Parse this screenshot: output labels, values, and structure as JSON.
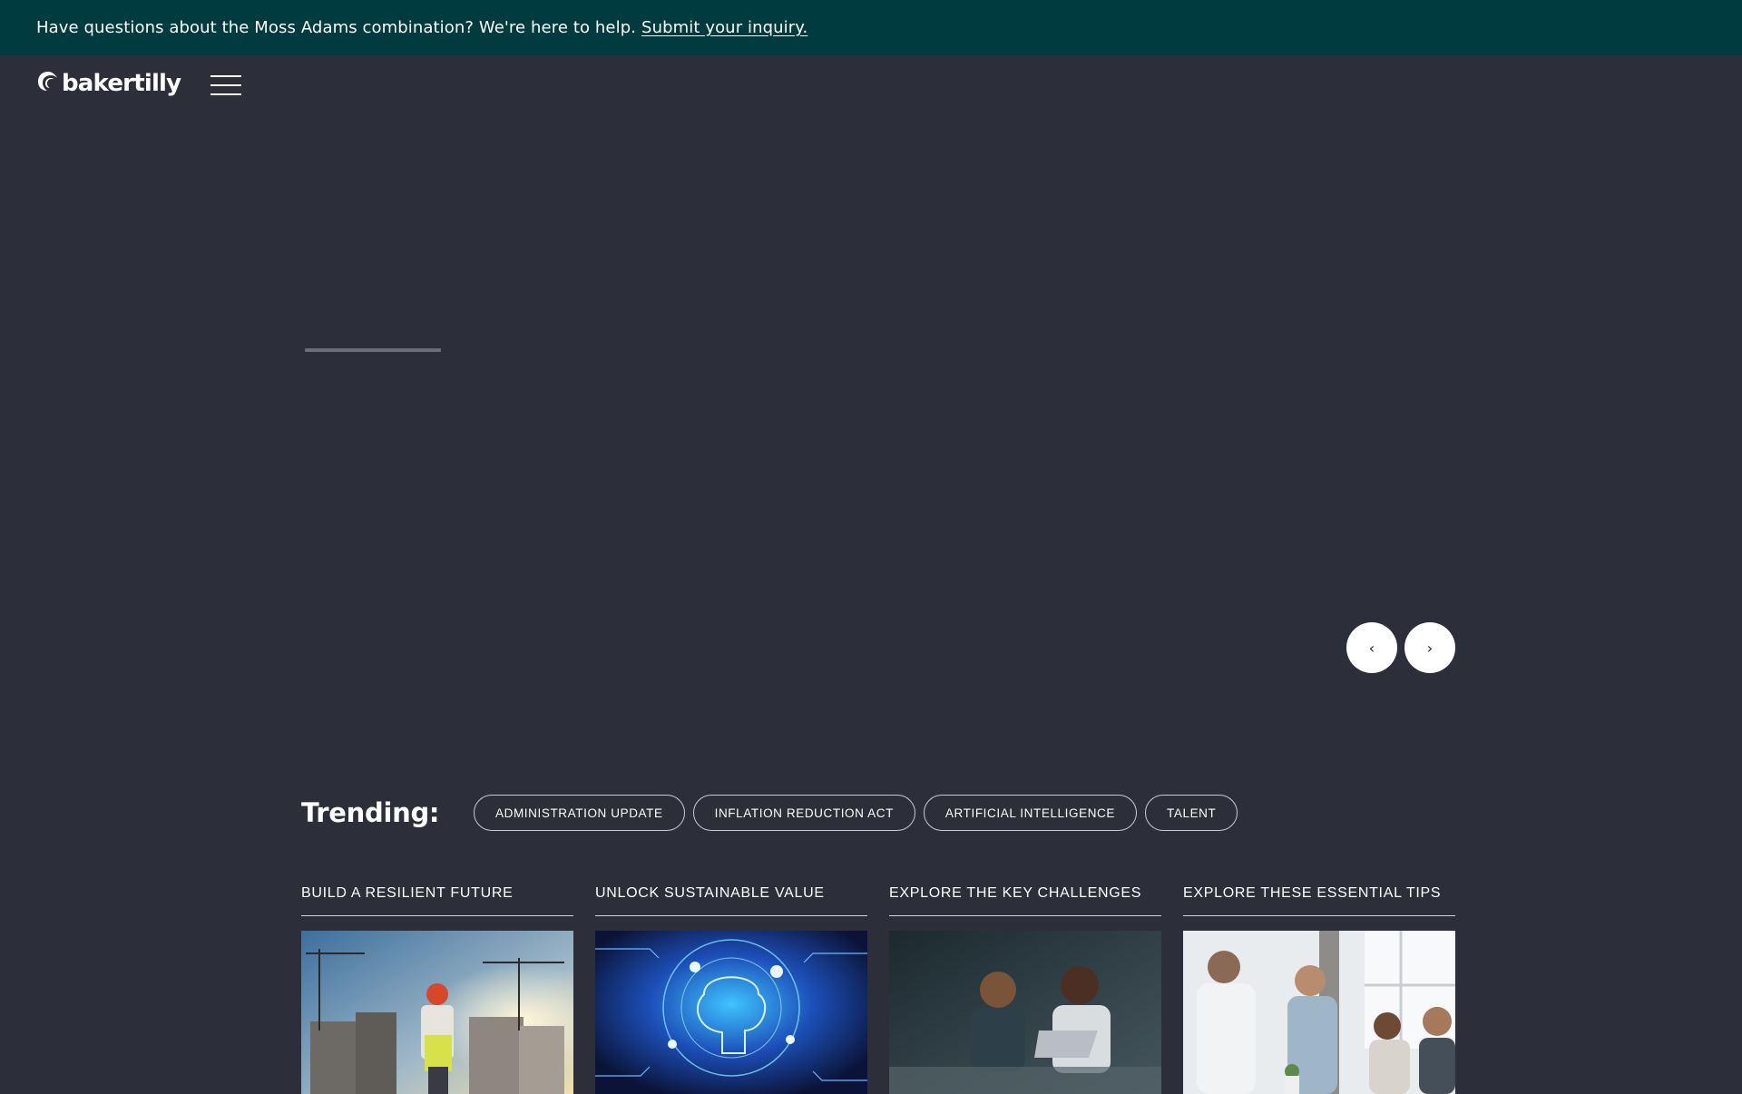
{
  "announcement": {
    "text": "Have questions about the Moss Adams combination? We're here to help.",
    "link_text": "Submit your inquiry."
  },
  "header": {
    "logo_text": "bakertilly",
    "menu_icon": "hamburger-menu-icon"
  },
  "hero": {
    "slide_progress_percent": 0,
    "prev_symbol": "‹",
    "next_symbol": "›"
  },
  "trending": {
    "label": "Trending:",
    "tags": [
      "ADMINISTRATION UPDATE",
      "INFLATION REDUCTION ACT",
      "ARTIFICIAL INTELLIGENCE",
      "TALENT"
    ]
  },
  "cards": [
    {
      "title": "BUILD A RESILIENT FUTURE"
    },
    {
      "title": "UNLOCK SUSTAINABLE VALUE"
    },
    {
      "title": "EXPLORE THE KEY CHALLENGES"
    },
    {
      "title": "EXPLORE THESE ESSENTIAL TIPS"
    }
  ],
  "colors": {
    "page_background": "#2c2f3a",
    "announcement_background": "#003b40",
    "text": "#ffffff"
  }
}
